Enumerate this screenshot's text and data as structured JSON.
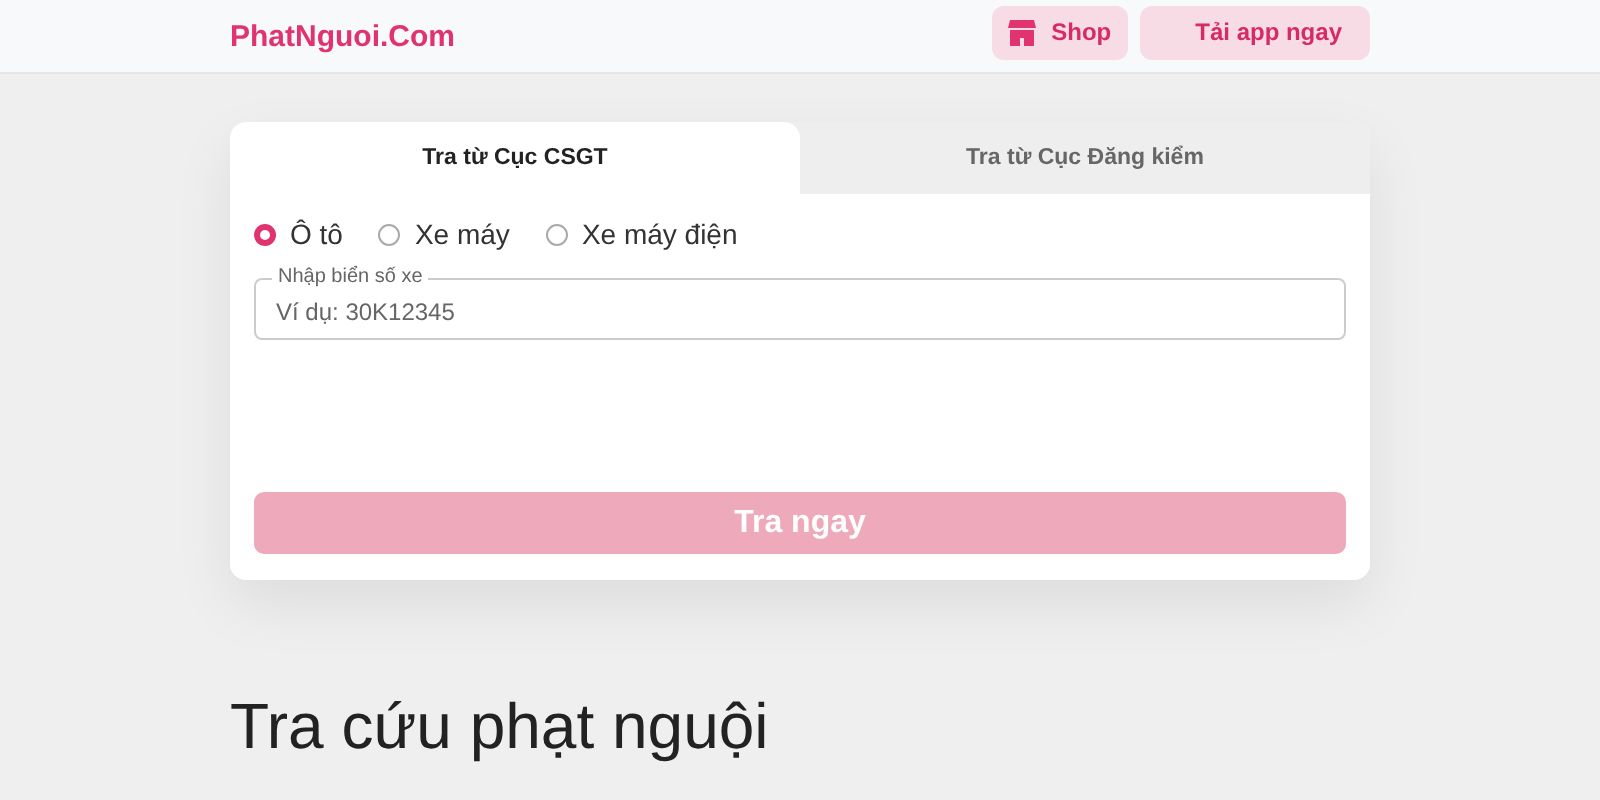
{
  "header": {
    "logo": "PhatNguoi.Com",
    "buttons": [
      {
        "kind": "shop",
        "label": "Shop"
      },
      {
        "kind": "app",
        "label": "Tải app ngay"
      }
    ]
  },
  "tabs": [
    {
      "label": "Tra từ Cục CSGT",
      "selected": true
    },
    {
      "label": "Tra từ Cục Đăng kiểm",
      "selected": false
    }
  ],
  "vehicle_types": [
    {
      "label": "Ô tô",
      "selected": true
    },
    {
      "label": "Xe máy",
      "selected": false
    },
    {
      "label": "Xe máy điện",
      "selected": false
    }
  ],
  "plate_field": {
    "label": "Nhập biển số xe",
    "placeholder": "Ví dụ: 30K12345"
  },
  "submit": {
    "label": "Tra ngay",
    "disabled": true
  },
  "heading": "Tra cứu phạt nguội"
}
